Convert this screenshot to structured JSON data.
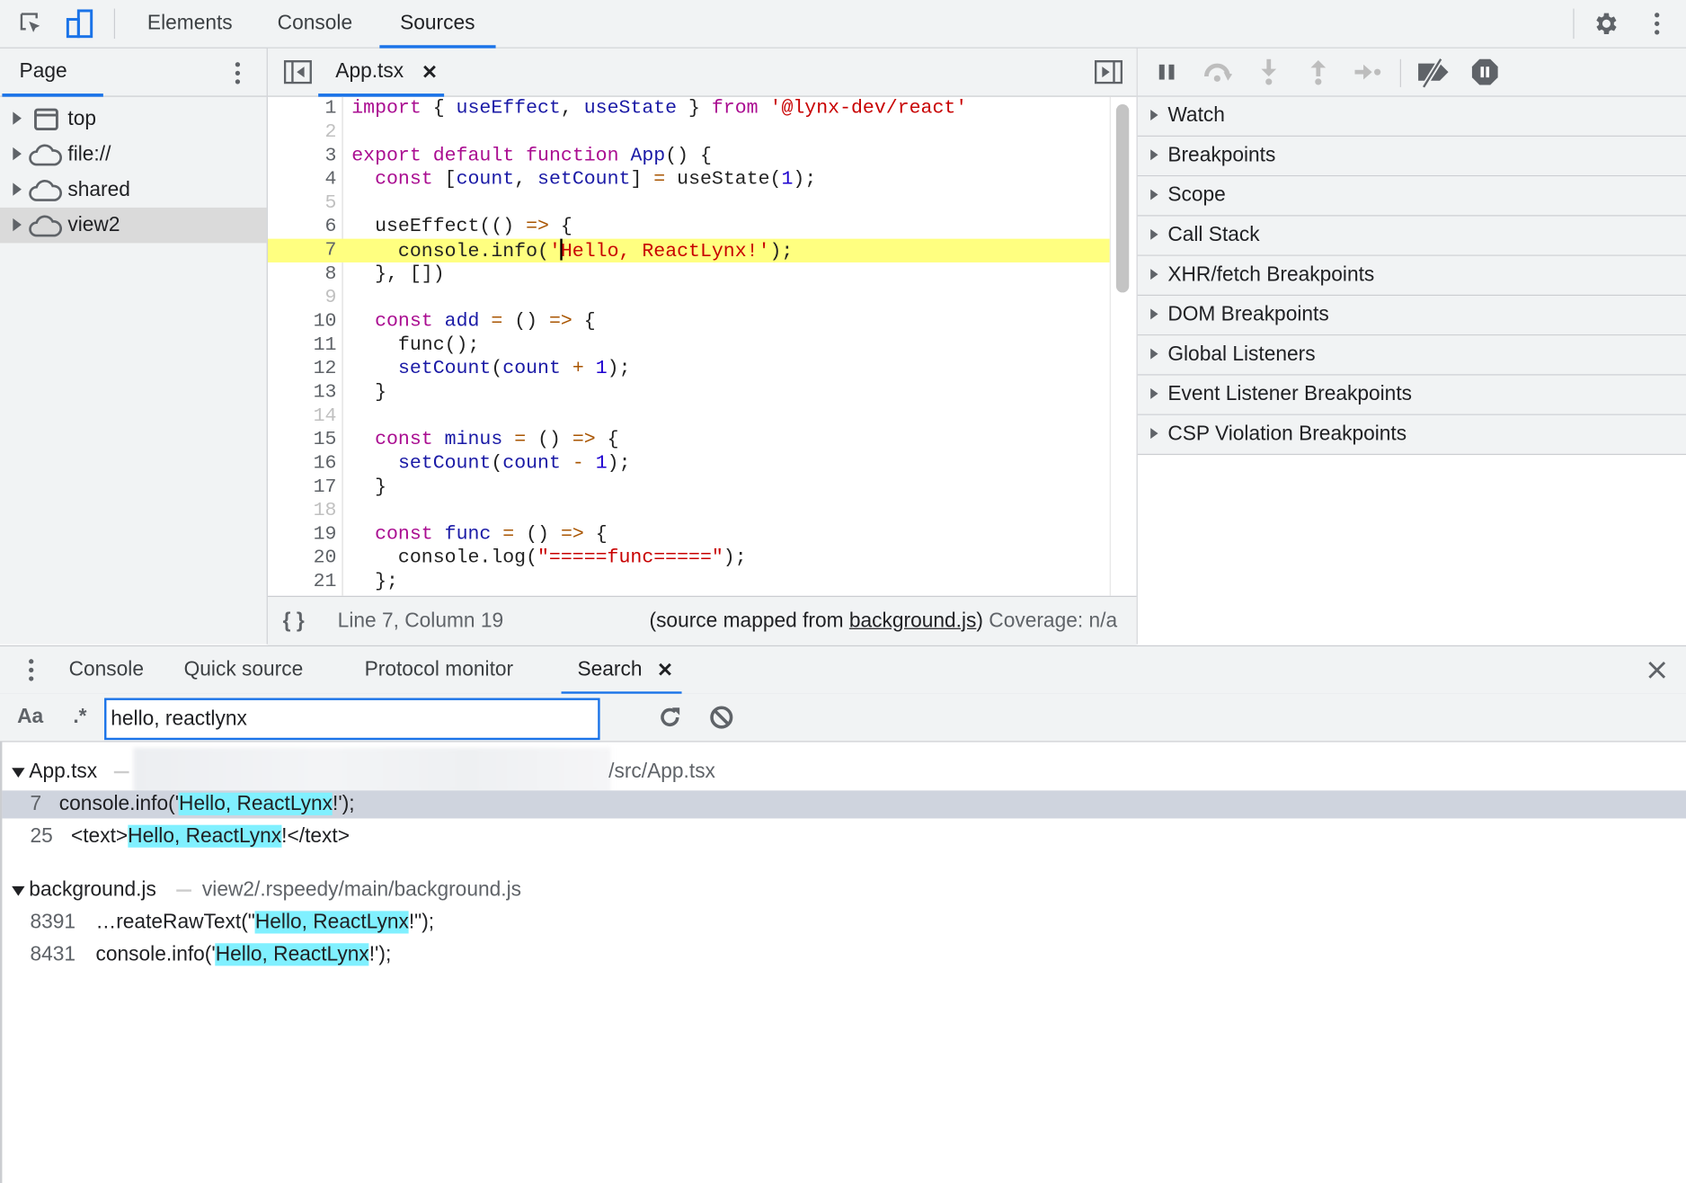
{
  "toolbar": {
    "tabs": [
      {
        "label": "Elements"
      },
      {
        "label": "Console"
      },
      {
        "label": "Sources",
        "active": true
      }
    ]
  },
  "navigator": {
    "tab": "Page",
    "items": [
      {
        "label": "top",
        "icon": "frame-icon"
      },
      {
        "label": "file://",
        "icon": "cloud-icon"
      },
      {
        "label": "shared",
        "icon": "cloud-icon"
      },
      {
        "label": "view2",
        "icon": "cloud-icon",
        "selected": true
      }
    ]
  },
  "editor": {
    "tab": "App.tsx",
    "cursor_line": 7,
    "lines": [
      [
        [
          "import",
          "kw"
        ],
        [
          " { ",
          "plain"
        ],
        [
          "useEffect",
          "def"
        ],
        [
          ", ",
          "plain"
        ],
        [
          "useState",
          "def"
        ],
        [
          " } ",
          "plain"
        ],
        [
          "from",
          "kw"
        ],
        [
          " ",
          "plain"
        ],
        [
          "'@lynx-dev/react'",
          "str"
        ]
      ],
      [],
      [
        [
          "export",
          "kw"
        ],
        [
          " ",
          "plain"
        ],
        [
          "default",
          "kw"
        ],
        [
          " ",
          "plain"
        ],
        [
          "function",
          "kw"
        ],
        [
          " ",
          "plain"
        ],
        [
          "App",
          "def"
        ],
        [
          "() {",
          "plain"
        ]
      ],
      [
        [
          "  ",
          "plain"
        ],
        [
          "const",
          "kw"
        ],
        [
          " [",
          "plain"
        ],
        [
          "count",
          "def"
        ],
        [
          ", ",
          "plain"
        ],
        [
          "setCount",
          "def"
        ],
        [
          "] ",
          "plain"
        ],
        [
          "=",
          "op"
        ],
        [
          " useState(",
          "plain"
        ],
        [
          "1",
          "num"
        ],
        [
          ");",
          "plain"
        ]
      ],
      [],
      [
        [
          "  useEffect(() ",
          "plain"
        ],
        [
          "=>",
          "op"
        ],
        [
          " {",
          "plain"
        ]
      ],
      [
        [
          "    console.info(",
          "plain"
        ],
        [
          "'",
          "str"
        ],
        [
          "CARET",
          ""
        ],
        [
          "Hello, ReactLynx!'",
          "str"
        ],
        [
          ");",
          "plain"
        ]
      ],
      [
        [
          "  }, [])",
          "plain"
        ]
      ],
      [],
      [
        [
          "  ",
          "plain"
        ],
        [
          "const",
          "kw"
        ],
        [
          " ",
          "plain"
        ],
        [
          "add",
          "def"
        ],
        [
          " ",
          "plain"
        ],
        [
          "=",
          "op"
        ],
        [
          " () ",
          "plain"
        ],
        [
          "=>",
          "op"
        ],
        [
          " {",
          "plain"
        ]
      ],
      [
        [
          "    func();",
          "plain"
        ]
      ],
      [
        [
          "    ",
          "plain"
        ],
        [
          "setCount",
          "def"
        ],
        [
          "(",
          "plain"
        ],
        [
          "count",
          "def"
        ],
        [
          " ",
          "plain"
        ],
        [
          "+",
          "op"
        ],
        [
          " ",
          "plain"
        ],
        [
          "1",
          "num"
        ],
        [
          ");",
          "plain"
        ]
      ],
      [
        [
          "  }",
          "plain"
        ]
      ],
      [],
      [
        [
          "  ",
          "plain"
        ],
        [
          "const",
          "kw"
        ],
        [
          " ",
          "plain"
        ],
        [
          "minus",
          "def"
        ],
        [
          " ",
          "plain"
        ],
        [
          "=",
          "op"
        ],
        [
          " () ",
          "plain"
        ],
        [
          "=>",
          "op"
        ],
        [
          " {",
          "plain"
        ]
      ],
      [
        [
          "    ",
          "plain"
        ],
        [
          "setCount",
          "def"
        ],
        [
          "(",
          "plain"
        ],
        [
          "count",
          "def"
        ],
        [
          " ",
          "plain"
        ],
        [
          "-",
          "op"
        ],
        [
          " ",
          "plain"
        ],
        [
          "1",
          "num"
        ],
        [
          ");",
          "plain"
        ]
      ],
      [
        [
          "  }",
          "plain"
        ]
      ],
      [],
      [
        [
          "  ",
          "plain"
        ],
        [
          "const",
          "kw"
        ],
        [
          " ",
          "plain"
        ],
        [
          "func",
          "def"
        ],
        [
          " ",
          "plain"
        ],
        [
          "=",
          "op"
        ],
        [
          " () ",
          "plain"
        ],
        [
          "=>",
          "op"
        ],
        [
          " {",
          "plain"
        ]
      ],
      [
        [
          "    console.log(",
          "plain"
        ],
        [
          "\"=====func=====\"",
          "str"
        ],
        [
          ");",
          "plain"
        ]
      ],
      [
        [
          "  };",
          "plain"
        ]
      ]
    ],
    "footer": {
      "position": "Line 7, Column 19",
      "mapped_prefix": "(source mapped from ",
      "mapped_link": "background.js",
      "mapped_suffix": ")",
      "coverage": "Coverage: n/a"
    }
  },
  "debugger": {
    "sections": [
      "Watch",
      "Breakpoints",
      "Scope",
      "Call Stack",
      "XHR/fetch Breakpoints",
      "DOM Breakpoints",
      "Global Listeners",
      "Event Listener Breakpoints",
      "CSP Violation Breakpoints"
    ]
  },
  "drawer": {
    "tabs": [
      {
        "label": "Console"
      },
      {
        "label": "Quick source"
      },
      {
        "label": "Protocol monitor"
      },
      {
        "label": "Search",
        "active": true,
        "closable": true
      }
    ],
    "search": {
      "case_label": "Aa",
      "regex_label": ".*",
      "query": "hello, reactlynx",
      "results": [
        {
          "file": "App.tsx",
          "path": "/src/App.tsx",
          "path_redacted": true,
          "matches": [
            {
              "line": "7",
              "pre": "console.info('",
              "match": "Hello, ReactLynx",
              "post": "!');",
              "selected": true
            },
            {
              "line": "25",
              "pre": "<text>",
              "match": "Hello, ReactLynx",
              "post": "!</text>"
            }
          ]
        },
        {
          "file": "background.js",
          "path": "view2/.rspeedy/main/background.js",
          "matches": [
            {
              "line": "8391",
              "pre": "…reateRawText(\"",
              "match": "Hello, ReactLynx",
              "post": "!\");"
            },
            {
              "line": "8431",
              "pre": "console.info('",
              "match": "Hello, ReactLynx",
              "post": "!');"
            }
          ]
        }
      ]
    }
  },
  "colors": {
    "accent": "#1a73e8",
    "highlight_line": "#ffff80",
    "match": "#80f0ff",
    "panel_bg": "#f1f3f4"
  }
}
